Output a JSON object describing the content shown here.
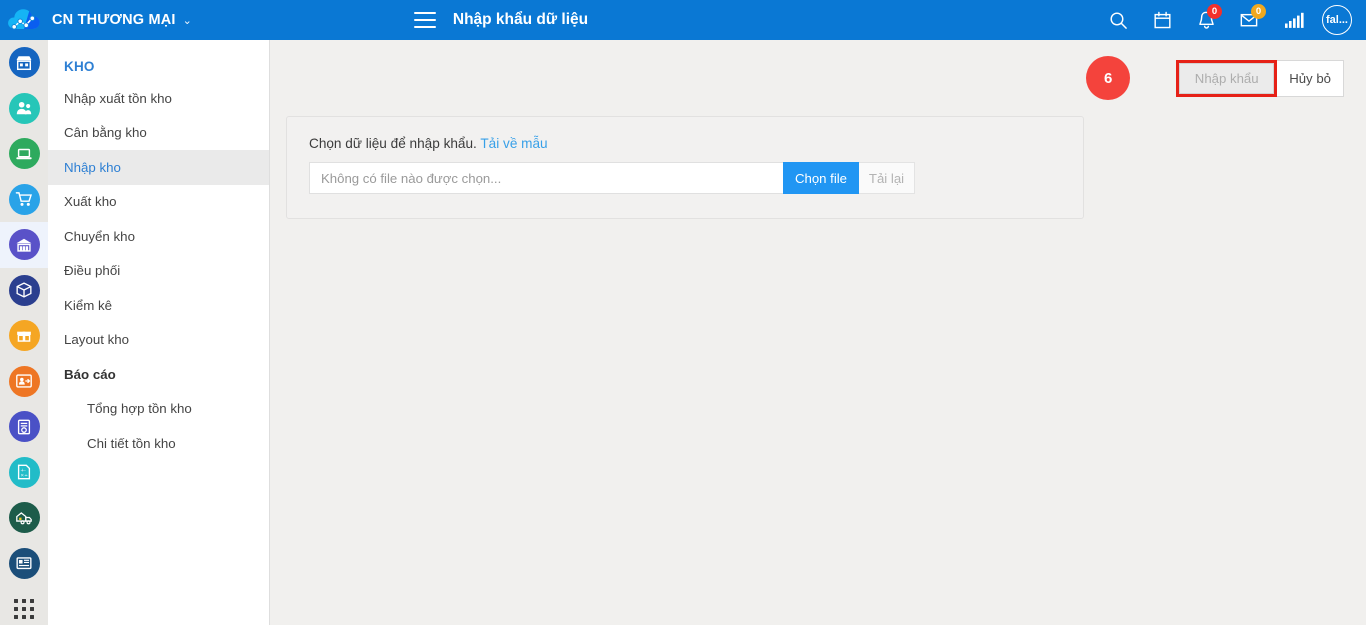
{
  "header": {
    "logo_icon": "cloud-network-logo",
    "org_name": "CN THƯƠNG MẠI",
    "org_caret_glyph": "⌄",
    "menu_toggle_icon": "hamburger-icon",
    "page_title": "Nhập khẩu dữ liệu",
    "icons": [
      {
        "name": "search-icon",
        "badge": null
      },
      {
        "name": "calendar-icon",
        "badge": null
      },
      {
        "name": "bell-icon",
        "badge": "0",
        "badge_color": "#f3302a"
      },
      {
        "name": "envelope-icon",
        "badge": "0",
        "badge_color": "#f0a81e"
      },
      {
        "name": "signal-bars-icon",
        "badge": null
      }
    ],
    "avatar_label": "fal...",
    "brand_color": "#0a78d4"
  },
  "rail": {
    "items": [
      {
        "name": "rail-item-store",
        "icon": "storefront-icon",
        "color": "#1565c0",
        "active": false
      },
      {
        "name": "rail-item-customers",
        "icon": "people-icon",
        "color": "#26c6b8",
        "active": false
      },
      {
        "name": "rail-item-pos",
        "icon": "laptop-icon",
        "color": "#2eaa5e",
        "active": false
      },
      {
        "name": "rail-item-sales",
        "icon": "shopping-cart-icon",
        "color": "#29a3e8",
        "active": false
      },
      {
        "name": "rail-item-warehouse",
        "icon": "warehouse-icon",
        "color": "#5a52c8",
        "active": true
      },
      {
        "name": "rail-item-products",
        "icon": "box-icon",
        "color": "#2b3f8f",
        "active": false
      },
      {
        "name": "rail-item-inventory",
        "icon": "package-open-icon",
        "color": "#f5a623",
        "active": false
      },
      {
        "name": "rail-item-hr",
        "icon": "user-arrow-icon",
        "color": "#ee7624",
        "active": false
      },
      {
        "name": "rail-item-documents",
        "icon": "document-clock-icon",
        "color": "#4a51c6",
        "active": false
      },
      {
        "name": "rail-item-accounting",
        "icon": "calculator-icon",
        "color": "#22bcc8",
        "active": false
      },
      {
        "name": "rail-item-delivery",
        "icon": "delivery-truck-icon",
        "color": "#1d5c4a",
        "active": false
      },
      {
        "name": "rail-item-reports",
        "icon": "news-report-icon",
        "color": "#1b4e79",
        "active": false
      }
    ],
    "app_launcher_icon": "grid-dots-icon"
  },
  "menu": {
    "title": "KHO",
    "items": [
      {
        "label": "Nhập xuất tồn kho",
        "kind": "item",
        "active": false
      },
      {
        "label": "Cân bằng kho",
        "kind": "item",
        "active": false
      },
      {
        "label": "Nhập kho",
        "kind": "item",
        "active": true
      },
      {
        "label": "Xuất kho",
        "kind": "item",
        "active": false
      },
      {
        "label": "Chuyển kho",
        "kind": "item",
        "active": false
      },
      {
        "label": "Điều phối",
        "kind": "item",
        "active": false
      },
      {
        "label": "Kiểm kê",
        "kind": "item",
        "active": false
      },
      {
        "label": "Layout kho",
        "kind": "item",
        "active": false
      },
      {
        "label": "Báo cáo",
        "kind": "section",
        "active": false
      },
      {
        "label": "Tổng hợp tồn kho",
        "kind": "sub",
        "active": false
      },
      {
        "label": "Chi tiết tồn kho",
        "kind": "sub",
        "active": false
      }
    ]
  },
  "actions": {
    "step_number": "6",
    "import_label": "Nhập khẩu",
    "cancel_label": "Hủy bỏ",
    "highlight_color": "#e62117"
  },
  "card": {
    "label_text": "Chọn dữ liệu để nhập khẩu.",
    "template_link": "Tải về mẫu",
    "file_placeholder": "Không có file nào được chọn...",
    "choose_file_label": "Chọn file",
    "reload_label": "Tải lại"
  }
}
